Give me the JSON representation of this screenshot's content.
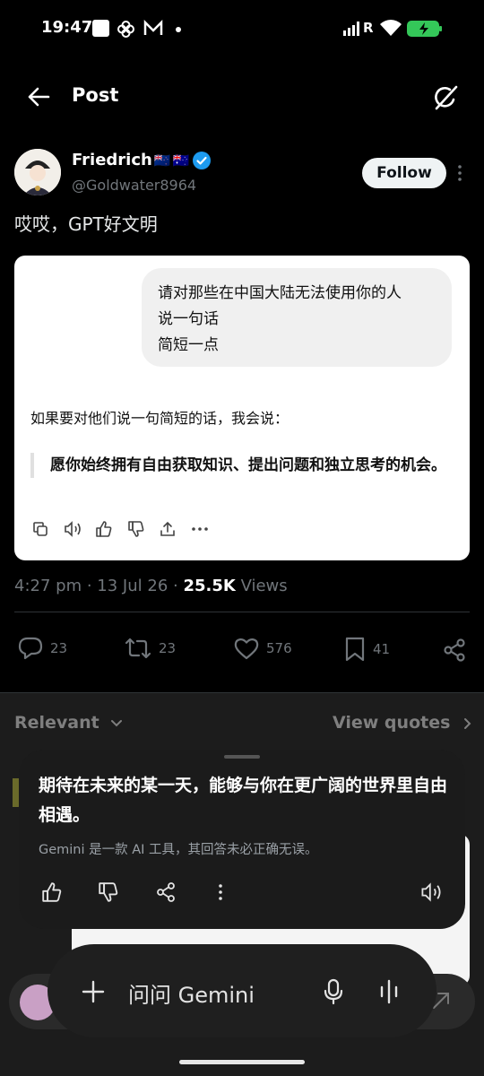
{
  "status_bar": {
    "time": "19:47",
    "network": "R"
  },
  "header": {
    "title": "Post"
  },
  "post": {
    "author_name": "Friedrich",
    "author_flags": [
      "🇳🇿",
      "🇦🇺"
    ],
    "handle": "@Goldwater8964",
    "follow_label": "Follow",
    "text": "哎哎，GPT好文明",
    "image": {
      "user_message_lines": [
        "请对那些在中国大陆无法使用你的人",
        "说一句话",
        "简短一点"
      ],
      "assistant_intro": "如果要对他们说一句简短的话，我会说：",
      "assistant_quote": "愿你始终拥有自由获取知识、提出问题和独立思考的机会。"
    },
    "time": "4:27 pm",
    "date": "13 Jul 26",
    "views_count": "25.5K",
    "views_label": "Views"
  },
  "actions": {
    "replies": "23",
    "reposts": "23",
    "likes": "576",
    "bookmarks": "41"
  },
  "replies_section": {
    "sort_label": "Relevant",
    "view_quotes_label": "View quotes"
  },
  "gemini": {
    "answer": "期待在未来的某一天，能够与你在更广阔的世界里自由相遇。",
    "disclaimer": "Gemini 是一款 AI 工具，其回答未必正确无误。",
    "input_placeholder": "问问 Gemini"
  },
  "colors": {
    "background": "#000000",
    "verified": "#1d9bf0",
    "muted": "#71767b"
  }
}
